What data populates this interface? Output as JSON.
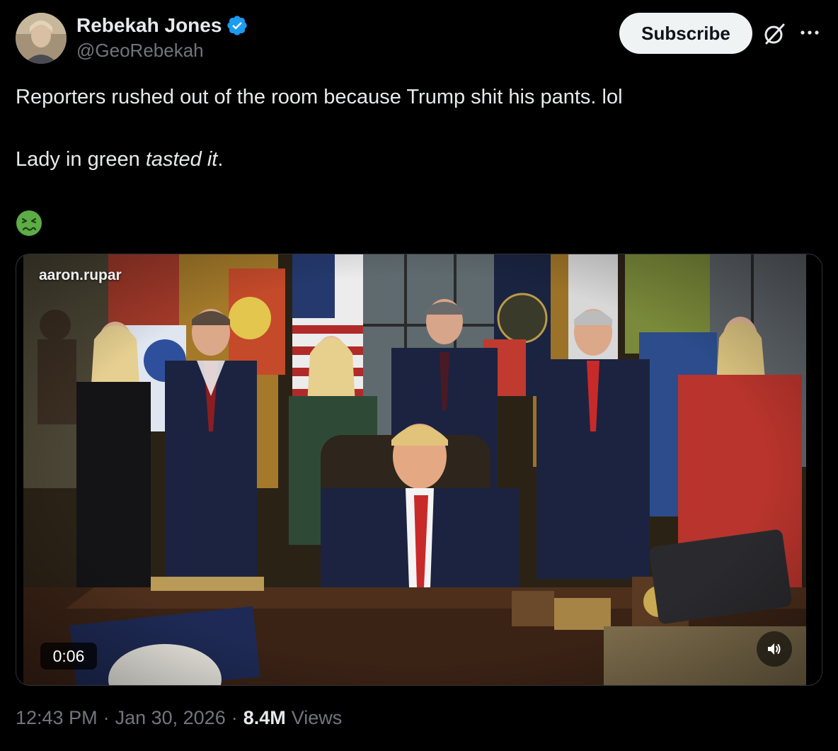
{
  "author": {
    "display_name": "Rebekah Jones",
    "handle": "@GeoRebekah",
    "verified_icon": "verified-badge-icon"
  },
  "actions": {
    "subscribe_label": "Subscribe",
    "grok_icon": "grok-icon",
    "more_icon": "more-icon"
  },
  "post": {
    "line1": "Reporters rushed out of the room because Trump shit his pants. lol",
    "line2_prefix": "Lady in green ",
    "line2_emphasis": "tasted it",
    "line2_suffix": ".",
    "emoji": "nauseated-face-emoji"
  },
  "media": {
    "watermark": "aaron.rupar",
    "duration": "0:06",
    "volume_icon": "speaker-icon"
  },
  "meta": {
    "time": "12:43 PM",
    "separator": "·",
    "date": "Jan 30, 2026",
    "views_count": "8.4M",
    "views_label": "Views"
  },
  "colors": {
    "background": "#000000",
    "text_primary": "#e7e9ea",
    "text_secondary": "#71767b",
    "verified_blue": "#1d9bf0",
    "subscribe_bg": "#eff3f4"
  }
}
